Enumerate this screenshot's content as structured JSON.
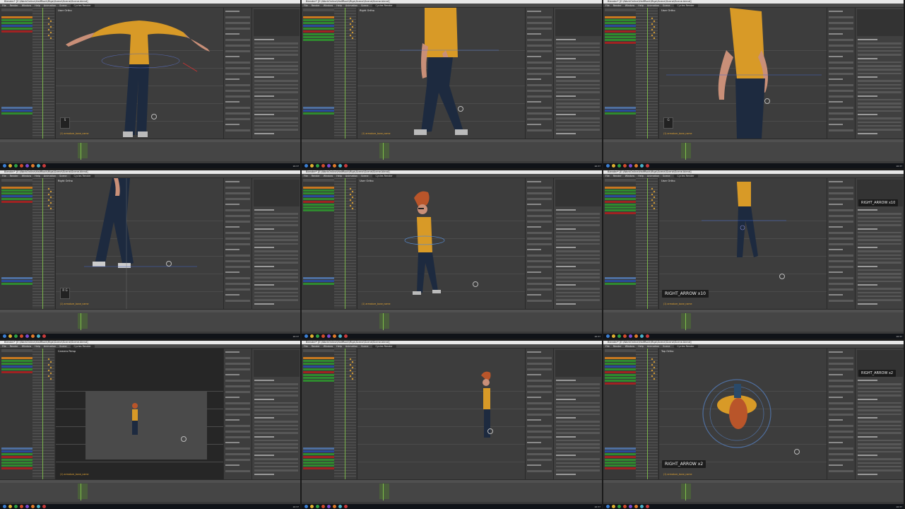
{
  "window_title": "Blender* [E:\\WorkOnline\\HalfRock\\Rigs\\Scene\\Scene\\Scene.blend]",
  "menu": [
    "File",
    "Render",
    "Window",
    "Help",
    "Animation",
    "Scene"
  ],
  "engine_label": "Cycles Render",
  "tiles": [
    {
      "view": "User Ortho",
      "key": "S",
      "overlay": "",
      "pose": "tpose",
      "objects": "(1) armature_bone_name"
    },
    {
      "view": "Right Ortho",
      "key": "",
      "overlay": "",
      "pose": "side-walk",
      "objects": "(1) armature_bone_name"
    },
    {
      "view": "User Ortho",
      "key": "G",
      "overlay": "",
      "pose": "closeup-torso",
      "objects": "(1) armature_bone_name"
    },
    {
      "view": "Right Ortho",
      "key": "R G",
      "overlay": "",
      "pose": "legs",
      "objects": "(1) armature_bone_name"
    },
    {
      "view": "User Ortho",
      "key": "",
      "overlay": "",
      "pose": "full-side",
      "objects": "(1) armature_bone_name"
    },
    {
      "view": "User Ortho",
      "key": "",
      "overlay": "RIGHT_ARROW x10",
      "overlay2": "RIGHT_ARROW x10",
      "pose": "small-walk",
      "objects": "(1) armature_bone_name"
    },
    {
      "view": "Camera Persp",
      "key": "",
      "overlay": "",
      "pose": "camera",
      "objects": "(1) armature_bone_name"
    },
    {
      "view": "",
      "key": "",
      "overlay": "",
      "pose": "render",
      "objects": ""
    },
    {
      "view": "Top Ortho",
      "key": "",
      "overlay": "RIGHT_ARROW x2",
      "overlay2": "RIGHT_ARROW x2",
      "pose": "top",
      "objects": "(1) armature_bone_name"
    }
  ],
  "colors": {
    "shirt": "#d89a27",
    "pants": "#1d2a3f",
    "skin": "#c98f78",
    "hair": "#b9552a",
    "channel_green": "#2f8a2f",
    "channel_red": "#a02222",
    "channel_blue": "#2a4a9a",
    "channel_orange": "#c7781f"
  },
  "clock": "16:37\n11/09/2016"
}
